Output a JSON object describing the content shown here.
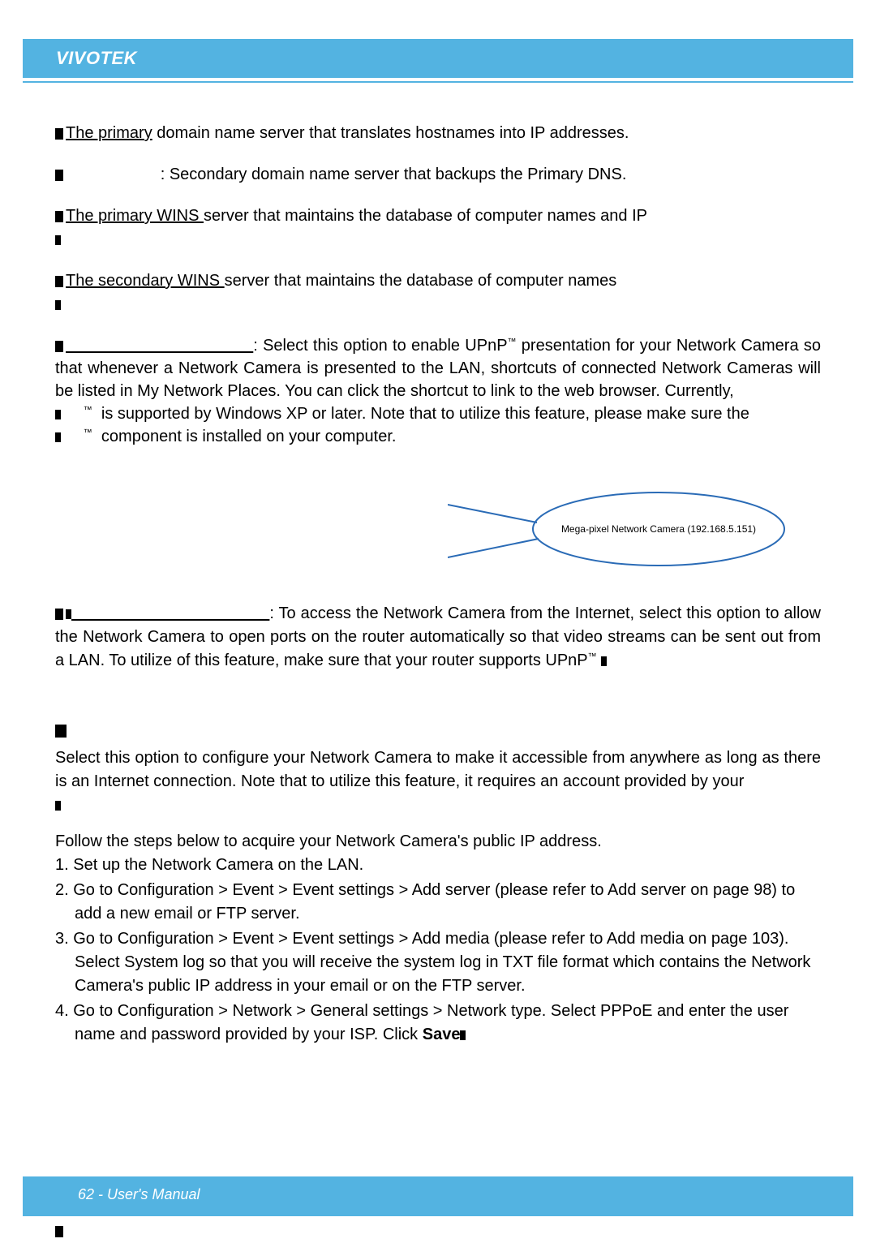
{
  "header": {
    "brand": "VIVOTEK"
  },
  "body": {
    "p1_a": "The primary",
    "p1_b": " domain name server that translates hostnames into IP addresses.",
    "p2_a": "",
    "p2_b": ": Secondary domain name server that backups the Primary DNS.",
    "p3_a": "The primary WINS ",
    "p3_b": "server that maintains the database of computer names and IP",
    "p4_a": "The secondary WINS ",
    "p4_b": "server that maintains the database of computer names",
    "upnp1_a": ": Select this option to enable UPnP",
    "upnp1_b": "  presentation for your Network Camera so that whenever a Network Camera is presented to the LAN, shortcuts of connected Network Cameras will be listed in My Network Places. You can click the shortcut to link to the web browser. Currently,",
    "upnp1_c": " is supported by Windows XP or later. Note that to utilize this feature, please make sure the",
    "upnp1_d": " component is installed on your computer.",
    "callout_label": "Mega-pixel Network Camera (192.168.5.151)",
    "upnp2_a": ": To access the Network Camera from the Internet, select this option to allow the Network Camera to open ports on the router automatically so that video streams can be sent out from a LAN. To utilize of this feature, make sure that your router supports UPnP",
    "pppoe_sel": "Select this option to configure your Network Camera to make it accessible from anywhere as long as there is an Internet connection. Note that to utilize this feature, it requires an account provided by your",
    "steps_intro": "Follow the steps below to acquire your Network Camera's public IP address.",
    "step1": "1. Set up the Network Camera on the LAN.",
    "step2": "2. Go to Configuration > Event > Event settings > Add server (please refer to Add server on page 98) to add a new email or FTP server.",
    "step3": "3. Go to Configuration > Event > Event settings > Add media (please refer to Add media on page 103). Select System log so that you will receive the system log in TXT file format which contains the Network Camera's public IP address in your email or on the FTP server.",
    "step4_a": "4. Go to Configuration > Network > General settings > Network type. Select PPPoE and enter the user name and password provided by your ISP. Click ",
    "step4_b": "Save",
    "tm": "™"
  },
  "footer": {
    "text": "62 - User's Manual"
  }
}
